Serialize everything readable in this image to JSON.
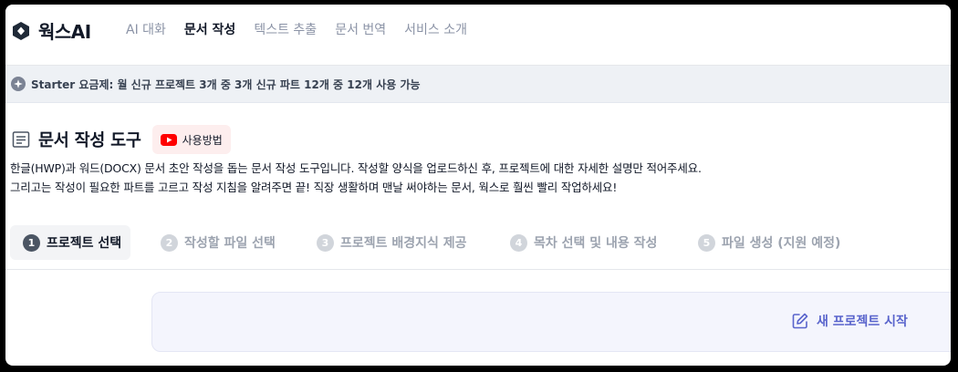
{
  "brand": {
    "name": "웍스AI",
    "logo_icon": "hexagon-logo-icon"
  },
  "nav": {
    "items": [
      {
        "label": "AI 대화",
        "active": false
      },
      {
        "label": "문서 작성",
        "active": true
      },
      {
        "label": "텍스트 추출",
        "active": false
      },
      {
        "label": "문서 번역",
        "active": false
      },
      {
        "label": "서비스 소개",
        "active": false
      }
    ]
  },
  "plan_banner": {
    "icon": "sparkle-badge-icon",
    "text": "Starter 요금제: 월 신규 프로젝트 3개 중 3개 신규 파트 12개 중 12개 사용 가능"
  },
  "page": {
    "title": "문서 작성 도구",
    "title_icon": "document-lines-icon",
    "howto_label": "사용방법",
    "howto_icon": "youtube-icon",
    "description_line1": "한글(HWP)과 워드(DOCX) 문서 초안 작성을 돕는 문서 작성 도구입니다. 작성할 양식을 업로드하신 후, 프로젝트에 대한 자세한 설명만 적어주세요.",
    "description_line2": "그리고는 작성이 필요한 파트를 고르고 작성 지침을 알려주면 끝! 직장 생활하며 맨날 써야하는 문서, 웍스로 훨씬 빨리 작업하세요!"
  },
  "steps": [
    {
      "num": "1",
      "label": "프로젝트 선택",
      "active": true
    },
    {
      "num": "2",
      "label": "작성할 파일 선택",
      "active": false
    },
    {
      "num": "3",
      "label": "프로젝트 배경지식 제공",
      "active": false
    },
    {
      "num": "4",
      "label": "목차 선택 및 내용 작성",
      "active": false
    },
    {
      "num": "5",
      "label": "파일 생성 (지원 예정)",
      "active": false
    }
  ],
  "new_project": {
    "label": "새 프로젝트 시작",
    "icon": "edit-icon"
  },
  "colors": {
    "accent": "#5964cc",
    "banner_bg": "#eef1f5",
    "youtube_red": "#ff0000",
    "howto_bg": "#fdeeee"
  }
}
